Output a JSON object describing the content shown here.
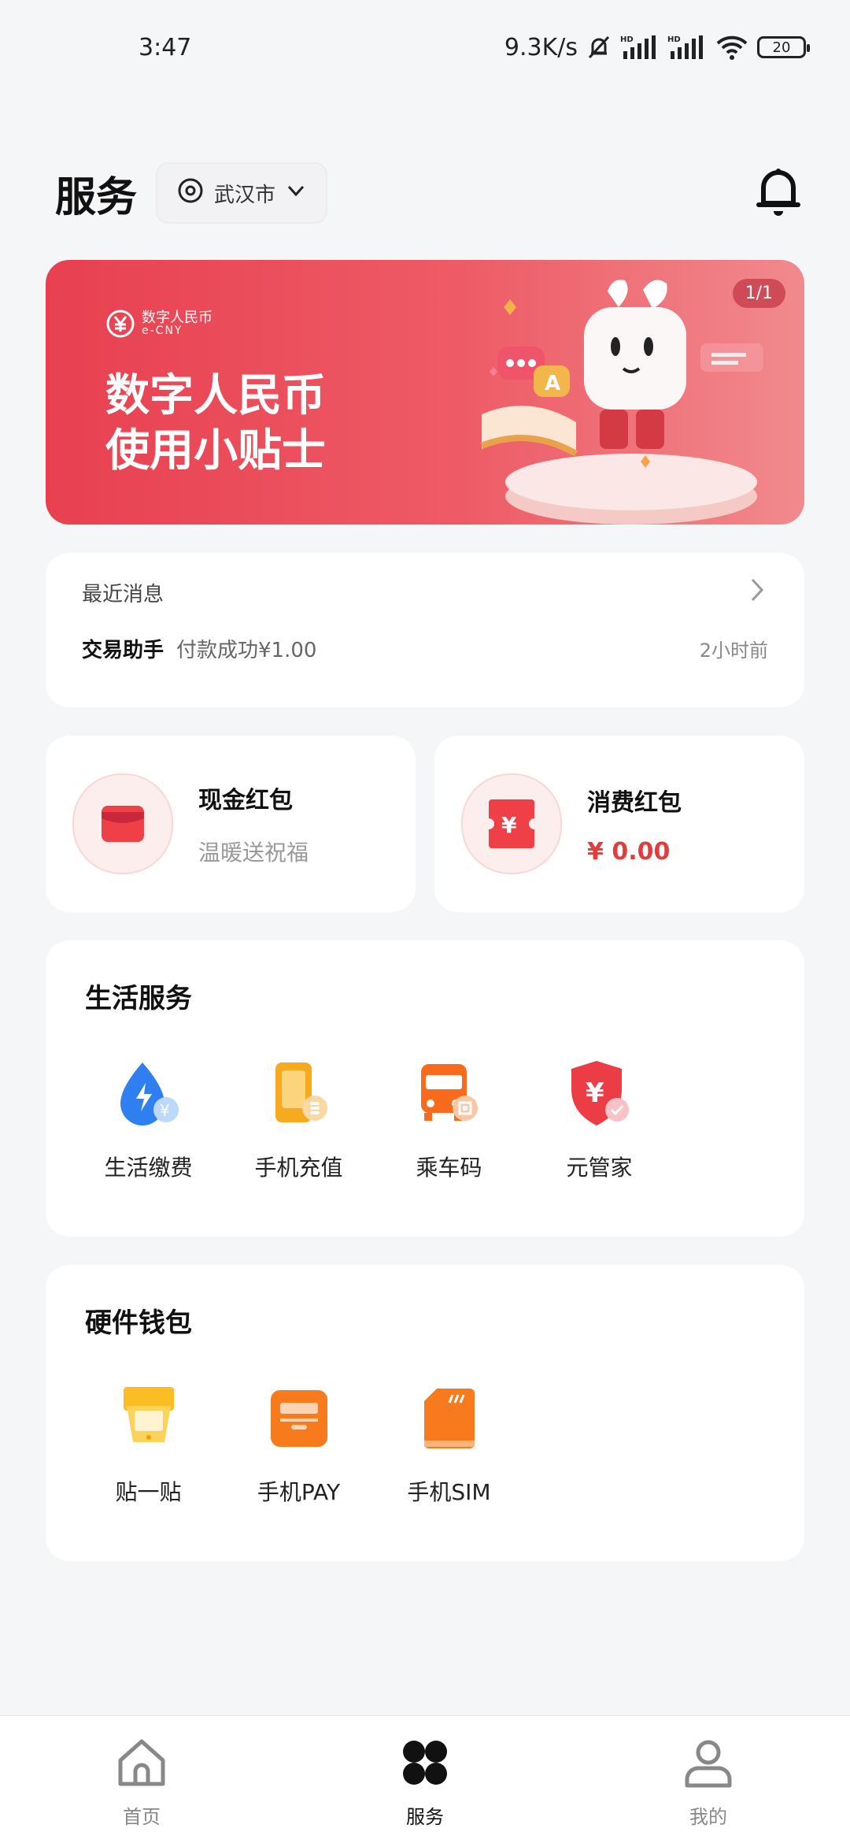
{
  "status_bar": {
    "time": "3:47",
    "network_speed": "9.3K/s",
    "battery": "20",
    "icons": [
      "mute-icon",
      "signal-hd-icon",
      "signal-hd-icon",
      "wifi-icon",
      "battery-icon"
    ]
  },
  "header": {
    "title": "服务",
    "location": "武汉市"
  },
  "banner": {
    "counter": "1/1",
    "logo_cn": "数字人民币",
    "logo_en": "e-CNY",
    "title_line1": "数字人民币",
    "title_line2": "使用小贴士",
    "accent_color": "#e84050"
  },
  "messages": {
    "heading": "最近消息",
    "sender": "交易助手",
    "text": "付款成功¥1.00",
    "time": "2小时前"
  },
  "red_packets": [
    {
      "title": "现金红包",
      "subtitle": "温暖送祝福"
    },
    {
      "title": "消费红包",
      "amount": "¥ 0.00"
    }
  ],
  "life_services": {
    "title": "生活服务",
    "items": [
      {
        "label": "生活缴费",
        "icon": "utility-bill-icon"
      },
      {
        "label": "手机充值",
        "icon": "phone-topup-icon"
      },
      {
        "label": "乘车码",
        "icon": "bus-code-icon"
      },
      {
        "label": "元管家",
        "icon": "yuan-shield-icon"
      }
    ]
  },
  "hardware_wallet": {
    "title": "硬件钱包",
    "items": [
      {
        "label": "贴一贴",
        "icon": "tap-card-icon"
      },
      {
        "label": "手机PAY",
        "icon": "phone-pay-icon"
      },
      {
        "label": "手机SIM",
        "icon": "sim-card-icon"
      }
    ]
  },
  "bottom_nav": [
    {
      "label": "首页",
      "icon": "home-icon",
      "active": false
    },
    {
      "label": "服务",
      "icon": "services-icon",
      "active": true
    },
    {
      "label": "我的",
      "icon": "profile-icon",
      "active": false
    }
  ]
}
